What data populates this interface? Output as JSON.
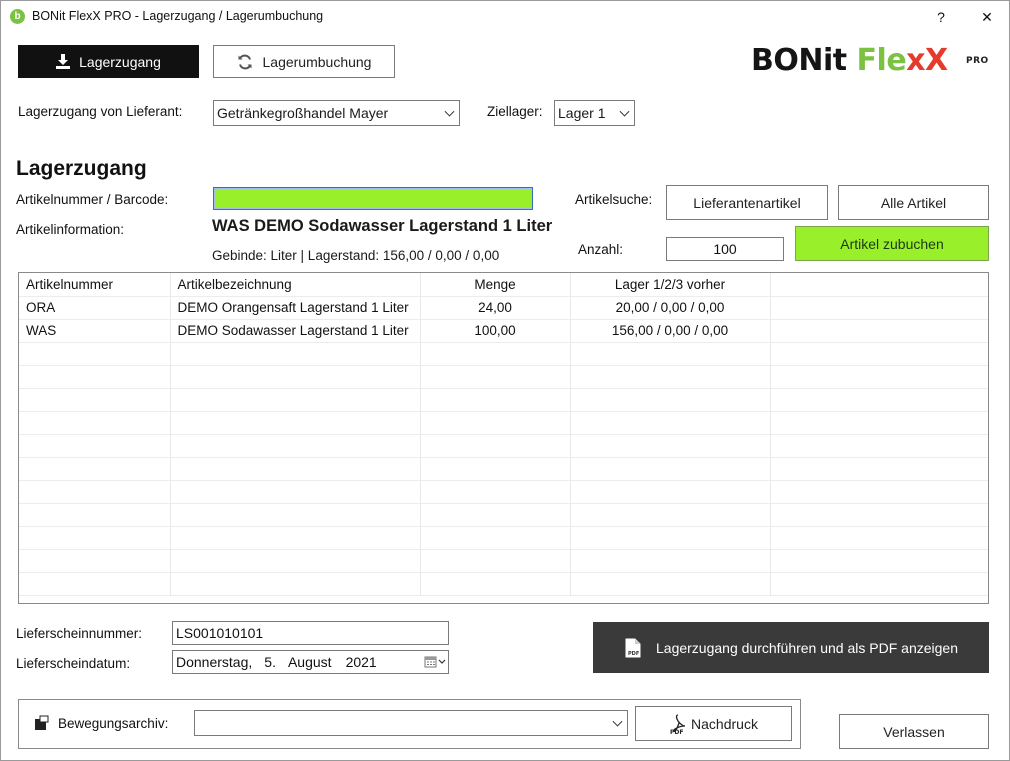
{
  "window": {
    "title": "BONit FlexX PRO - Lagerzugang / Lagerumbuchung",
    "help": "?",
    "close": "✕"
  },
  "toolbar": {
    "lagerzugang_label": "Lagerzugang",
    "lagerumbuchung_label": "Lagerumbuchung"
  },
  "logo": {
    "part1": "BONit ",
    "part2": "Fle",
    "part3": "xX",
    "pro": "PRO"
  },
  "supplier": {
    "label": "Lagerzugang von Lieferant:",
    "value": "Getränkegroßhandel Mayer"
  },
  "target_storage": {
    "label": "Ziellager:",
    "value": "Lager 1"
  },
  "section_title": "Lagerzugang",
  "article": {
    "barcode_label": "Artikelnummer / Barcode:",
    "barcode_value": "",
    "info_label": "Artikelinformation:",
    "info_name": "WAS DEMO Sodawasser Lagerstand 1 Liter",
    "info_details": "Gebinde: Liter | Lagerstand: 156,00 / 0,00 / 0,00",
    "search_label": "Artikelsuche:",
    "search_supplier_button": "Lieferantenartikel",
    "search_all_button": "Alle Artikel",
    "quantity_label": "Anzahl:",
    "quantity_value": "100",
    "add_button": "Artikel zubuchen"
  },
  "grid": {
    "columns": [
      "Artikelnummer",
      "Artikelbezeichnung",
      "Menge",
      "Lager 1/2/3 vorher",
      ""
    ],
    "rows": [
      [
        "ORA",
        "DEMO Orangensaft Lagerstand 1 Liter",
        "24,00",
        "20,00 / 0,00 / 0,00",
        ""
      ],
      [
        "WAS",
        "DEMO Sodawasser Lagerstand 1 Liter",
        "100,00",
        "156,00 / 0,00 / 0,00",
        ""
      ]
    ]
  },
  "delivery": {
    "number_label": "Lieferscheinnummer:",
    "number_value": "LS001010101",
    "date_label": "Lieferscheindatum:",
    "date_weekday": "Donnerstag,",
    "date_day": "5.",
    "date_month": "August",
    "date_year": "2021"
  },
  "execute_button": "Lagerzugang durchführen und als PDF anzeigen",
  "archive": {
    "label": "Bewegungsarchiv:",
    "value": "",
    "reprint_button": "Nachdruck"
  },
  "exit_button": "Verlassen",
  "colors": {
    "accent_green": "#99ef2a",
    "brand_green": "#7cc242",
    "brand_red": "#e53b2c",
    "dark_button": "#3a3a3a"
  }
}
